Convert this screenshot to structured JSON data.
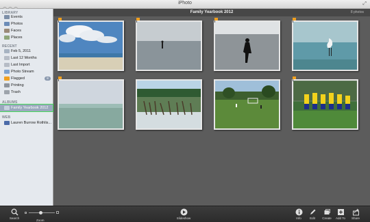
{
  "window": {
    "title": "iPhoto"
  },
  "sidebar": {
    "sections": {
      "library": "LIBRARY",
      "recent": "RECENT",
      "albums": "ALBUMS",
      "web": "WEB"
    },
    "library_items": [
      {
        "label": "Events",
        "icon": "events-icon"
      },
      {
        "label": "Photos",
        "icon": "photos-icon"
      },
      {
        "label": "Faces",
        "icon": "faces-icon"
      },
      {
        "label": "Places",
        "icon": "places-icon"
      }
    ],
    "recent_items": [
      {
        "label": "Feb 5, 2011",
        "icon": "event-icon"
      },
      {
        "label": "Last 12 Months",
        "icon": "calendar-icon"
      },
      {
        "label": "Last Import",
        "icon": "import-icon"
      },
      {
        "label": "Photo Stream",
        "icon": "photo-stream-icon"
      },
      {
        "label": "Flagged",
        "icon": "flag-icon",
        "badge": "8"
      },
      {
        "label": "Printing",
        "icon": "printing-icon"
      },
      {
        "label": "Trash",
        "icon": "trash-icon"
      }
    ],
    "album_items": [
      {
        "label": "Family Yearbook 2012",
        "icon": "album-icon",
        "selected": true
      }
    ],
    "web_items": [
      {
        "label": "Lauren Burrow Rothlis...",
        "icon": "web-icon"
      }
    ]
  },
  "event": {
    "title": "Family Yearbook 2012",
    "count": "8 photos"
  },
  "photos": [
    {
      "name": "photo-beach-sky",
      "flagged": true
    },
    {
      "name": "photo-person-in-water",
      "flagged": true
    },
    {
      "name": "photo-fisherman-silhouette",
      "flagged": true
    },
    {
      "name": "photo-egret-shore",
      "flagged": true
    },
    {
      "name": "photo-calm-sea",
      "flagged": true
    },
    {
      "name": "photo-mangrove-roots",
      "flagged": false
    },
    {
      "name": "photo-soccer-field",
      "flagged": false
    },
    {
      "name": "photo-soccer-team",
      "flagged": true
    }
  ],
  "toolbar": {
    "search": "Search",
    "zoom": "Zoom",
    "zoom_level": 0.45,
    "slideshow": "Slideshow",
    "info": "Info",
    "edit": "Edit",
    "create": "Create",
    "add_to": "Add To",
    "share": "Share"
  },
  "colors": {
    "selection_outline": "#46d95a",
    "flag": "#f0a020",
    "content_bg": "#5c5c5c"
  }
}
